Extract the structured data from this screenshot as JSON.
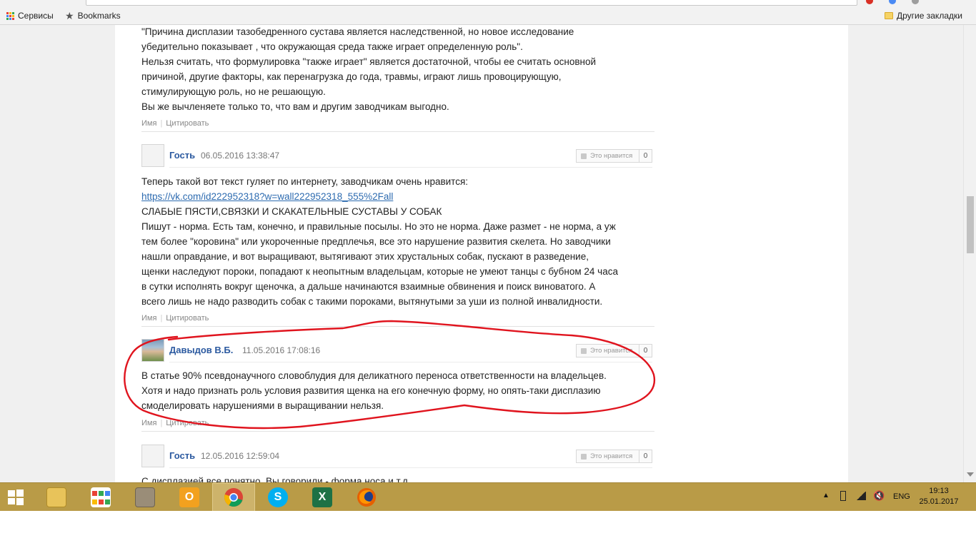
{
  "browser": {
    "bookmarks_bar": {
      "apps_label": "Сервисы",
      "bookmarks_label": "Bookmarks",
      "other_bookmarks_label": "Другие закладки"
    }
  },
  "comments": [
    {
      "text_lines": [
        "\"Причина дисплазии тазобедренного сустава является наследственной, но новое исследование",
        "убедительно показывает , что окружающая среда также играет определенную роль\".",
        "Нельзя считать, что формулировка \"также играет\" является достаточной, чтобы ее считать основной",
        "причиной, другие факторы, как перенагрузка до года, травмы, играют лишь провоцирующую,",
        "стимулирующую роль, но не решающую.",
        "Вы же вычленяете только то, что вам и другим заводчикам выгодно."
      ],
      "action_name": "Имя",
      "action_quote": "Цитировать"
    },
    {
      "author": "Гость",
      "date": "06.05.2016 13:38:47",
      "like_label": "Это нравится",
      "like_count": "0",
      "text_line_1": "Теперь такой вот текст гуляет по интернету, заводчикам очень нравится:",
      "link": "https://vk.com/id222952318?w=wall222952318_555%2Fall",
      "text_lines": [
        "СЛАБЫЕ ПЯСТИ,СВЯЗКИ И СКАКАТЕЛЬНЫЕ СУСТАВЫ У СОБАК",
        "Пишут - норма. Есть там, конечно, и правильные посылы. Но это не норма. Даже размет - не норма, а уж",
        "тем более \"коровина\" или укороченные предплечья, все это нарушение развития скелета. Но заводчики",
        "нашли оправдание, и вот выращивают, вытягивают этих хрустальных собак, пускают в разведение,",
        "щенки наследуют пороки, попадают к неопытным владельцам, которые не умеют танцы с бубном 24 часа",
        "в сутки исполнять вокруг щеночка, а дальше начинаются взаимные обвинения и поиск виноватого. А",
        "всего лишь не надо разводить собак с такими пороками, вытянутыми за уши из полной инвалидности."
      ],
      "action_name": "Имя",
      "action_quote": "Цитировать"
    },
    {
      "author": "Давыдов В.Б.",
      "date": "11.05.2016 17:08:16",
      "like_label": "Это нравится",
      "like_count": "0",
      "text_lines": [
        "В статье 90% псевдонаучного словоблудия для деликатного переноса ответственности на владельцев.",
        "Хотя и надо признать роль условия развития щенка на его конечную форму, но опять-таки дисплазию",
        "смоделировать нарушениями в выращивании нельзя."
      ],
      "action_name": "Имя",
      "action_quote": "Цитировать"
    },
    {
      "author": "Гость",
      "date": "12.05.2016 12:59:04",
      "like_label": "Это нравится",
      "like_count": "0",
      "text_partial": "С дисплазией все понятно. Вы говорили - форма носа и т.д."
    }
  ],
  "annotation_color": "#e0141e",
  "taskbar": {
    "apps": [
      {
        "icon": "windows-start-icon"
      },
      {
        "icon": "file-explorer-icon"
      },
      {
        "icon": "store-apps-icon"
      },
      {
        "icon": "archive-app-icon"
      },
      {
        "icon": "outlook-icon",
        "glyph": "O"
      },
      {
        "icon": "chrome-icon"
      },
      {
        "icon": "skype-icon",
        "glyph": "S"
      },
      {
        "icon": "excel-icon",
        "glyph": "X"
      },
      {
        "icon": "firefox-icon"
      }
    ],
    "language": "ENG",
    "time": "19:13",
    "date": "25.01.2017",
    "color": "#b99b47"
  }
}
